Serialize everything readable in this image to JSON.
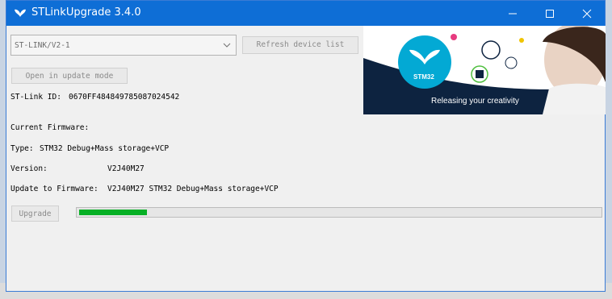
{
  "window": {
    "title": "STLinkUpgrade 3.4.0"
  },
  "device": {
    "selected": "ST-LINK/V2-1",
    "refresh_label": "Refresh device list",
    "update_mode_label": "Open in update mode",
    "id_label": "ST-Link ID:",
    "id_value": "0670FF484849785087024542"
  },
  "firmware": {
    "current_label": "Current Firmware:",
    "type_label": "Type:",
    "type_value": "STM32 Debug+Mass storage+VCP",
    "version_label": "Version:",
    "version_value": "V2J40M27",
    "update_label": "Update to Firmware:",
    "update_value": "V2J40M27 STM32 Debug+Mass storage+VCP"
  },
  "upgrade": {
    "button_label": "Upgrade",
    "progress": 0.13
  },
  "banner": {
    "logo_text": "STM32",
    "tagline": "Releasing your creativity"
  },
  "colors": {
    "titlebar": "#0e6ed6",
    "progress_fill": "#06b025",
    "banner_dark": "#0d2340",
    "st_blue": "#03a9d4"
  },
  "icons": {
    "app": "st-butterfly-icon",
    "minimize": "minimize-icon",
    "maximize": "maximize-icon",
    "close": "close-icon",
    "dropdown": "chevron-down-icon"
  }
}
